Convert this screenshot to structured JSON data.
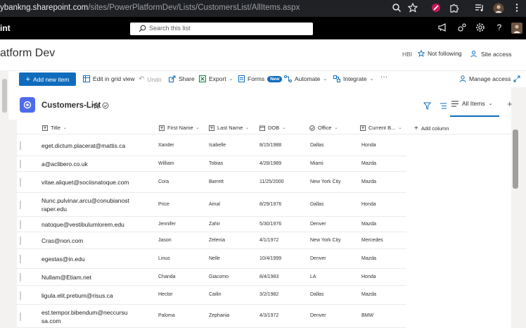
{
  "browser": {
    "url_host": "ybankng.sharepoint.com",
    "url_path": "/sites/PowerPlatformDev/Lists/CustomersList/AllItems.aspx",
    "icons": [
      "zoom-icon",
      "star-icon",
      "extension-red-icon",
      "puzzle-icon",
      "media-icon",
      "profile-icon",
      "kebab-menu-icon"
    ]
  },
  "suite": {
    "app_name": "int",
    "search_placeholder": "Search this list"
  },
  "site": {
    "title": "atform Dev",
    "hbi": "HBI",
    "not_following": "Not following",
    "site_access": "Site access"
  },
  "commands": {
    "new_item": "Add new item",
    "edit_grid": "Edit in grid view",
    "undo": "Undo",
    "share": "Share",
    "export": "Export",
    "forms": "Forms",
    "forms_badge": "New",
    "automate": "Automate",
    "integrate": "Integrate",
    "more": "···",
    "manage_access": "Manage access"
  },
  "list": {
    "name": "Customers-List",
    "view_name": "All Items",
    "add_view": "+",
    "accent": "#4f6bed"
  },
  "columns": {
    "title": "Title",
    "first_name": "First Name",
    "last_name": "Last Name",
    "dob": "DOB",
    "office": "Office",
    "current": "Current B...",
    "add": "Add column"
  },
  "rows": [
    {
      "title": "eget.dictum.placerat@mattis.ca",
      "first": "Xander",
      "last": "Isabelle",
      "dob": "8/15/1988",
      "office": "Dallas",
      "car": "Honda"
    },
    {
      "title": "a@aclibero.co.uk",
      "first": "William",
      "last": "Tobias",
      "dob": "4/28/1989",
      "office": "Miami",
      "car": "Mazda"
    },
    {
      "title": "vitae.aliquet@sociisnatoque.com",
      "first": "Cora",
      "last": "Barrett",
      "dob": "11/25/2000",
      "office": "New York City",
      "car": "Mazda"
    },
    {
      "title": "Nunc.pulvinar.arcu@conubianostraper.edu",
      "first": "Price",
      "last": "Amal",
      "dob": "8/29/1976",
      "office": "Dallas",
      "car": "Honda"
    },
    {
      "title": "natoque@vestibulumlorem.edu",
      "first": "Jennifer",
      "last": "Zahir",
      "dob": "5/30/1976",
      "office": "Denver",
      "car": "Mazda"
    },
    {
      "title": "Cras@non.com",
      "first": "Jason",
      "last": "Zelenia",
      "dob": "4/1/1972",
      "office": "New York City",
      "car": "Mercedes"
    },
    {
      "title": "egestas@in.edu",
      "first": "Linus",
      "last": "Nelle",
      "dob": "10/4/1999",
      "office": "Denver",
      "car": "Mazda"
    },
    {
      "title": "Nullam@Etiam.net",
      "first": "Chanda",
      "last": "Giacomo",
      "dob": "8/4/1983",
      "office": "LA",
      "car": "Honda"
    },
    {
      "title": "ligula.elit.pretium@risus.ca",
      "first": "Hector",
      "last": "Cailin",
      "dob": "3/2/1982",
      "office": "Dallas",
      "car": "Mazda"
    },
    {
      "title": "est.tempor.bibendum@neccursusa.com",
      "first": "Paloma",
      "last": "Zephania",
      "dob": "4/3/1972",
      "office": "Denver",
      "car": "BMW"
    }
  ]
}
